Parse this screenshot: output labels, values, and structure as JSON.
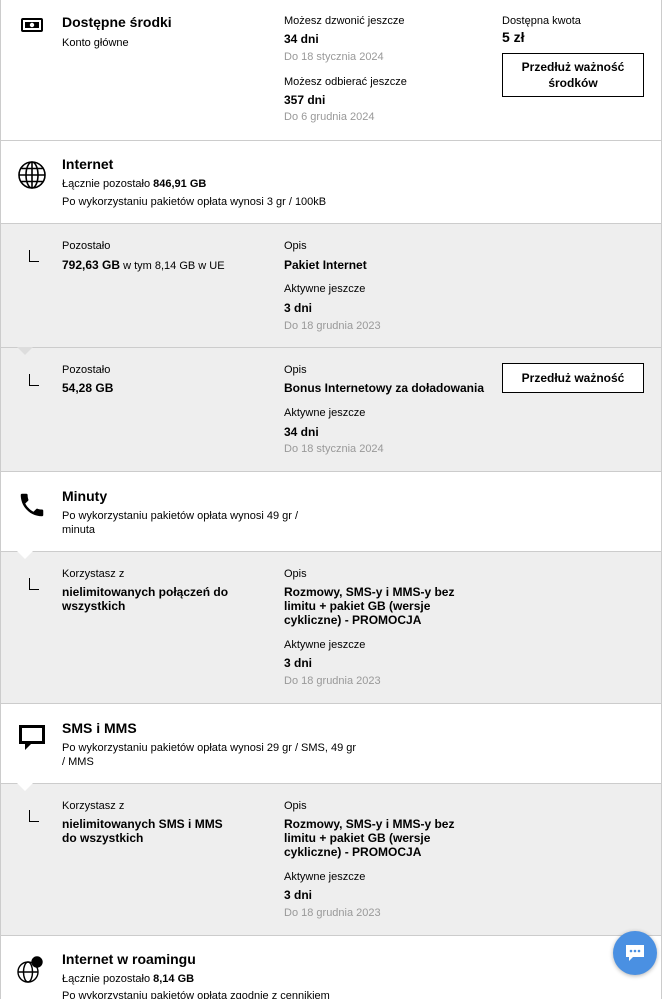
{
  "funds": {
    "title": "Dostępne środki",
    "subtitle": "Konto główne",
    "call_label": "Możesz dzwonić jeszcze",
    "call_value": "34 dni",
    "call_date": "Do 18 stycznia 2024",
    "receive_label": "Możesz odbierać jeszcze",
    "receive_value": "357 dni",
    "receive_date": "Do 6 grudnia 2024",
    "amount_label": "Dostępna kwota",
    "amount_value": "5 zł",
    "extend_button": "Przedłuż ważność środków"
  },
  "internet": {
    "title": "Internet",
    "total_prefix": "Łącznie pozostało",
    "total_value": "846,91 GB",
    "after_note": "Po wykorzystaniu pakietów opłata wynosi 3 gr / 100kB",
    "packages": [
      {
        "left_label": "Pozostało",
        "left_value": "792,63 GB",
        "left_extra": "w tym 8,14 GB w UE",
        "desc_label": "Opis",
        "desc_value": "Pakiet Internet",
        "active_label": "Aktywne jeszcze",
        "active_value": "3 dni",
        "active_date": "Do 18 grudnia 2023"
      },
      {
        "left_label": "Pozostało",
        "left_value": "54,28 GB",
        "left_extra": "",
        "desc_label": "Opis",
        "desc_value": "Bonus Internetowy za doładowania",
        "active_label": "Aktywne jeszcze",
        "active_value": "34 dni",
        "active_date": "Do 18 stycznia 2024",
        "button": "Przedłuż ważność"
      }
    ]
  },
  "minutes": {
    "title": "Minuty",
    "after_note": "Po wykorzystaniu pakietów opłata wynosi 49 gr / minuta",
    "package": {
      "left_label": "Korzystasz z",
      "left_value": "nielimitowanych połączeń do wszystkich",
      "desc_label": "Opis",
      "desc_value": "Rozmowy, SMS-y i MMS-y bez limitu + pakiet GB (wersje cykliczne) - PROMOCJA",
      "active_label": "Aktywne jeszcze",
      "active_value": "3 dni",
      "active_date": "Do 18 grudnia 2023"
    }
  },
  "sms": {
    "title": "SMS i MMS",
    "after_note": "Po wykorzystaniu pakietów opłata wynosi 29 gr / SMS, 49 gr / MMS",
    "package": {
      "left_label": "Korzystasz z",
      "left_value": "nielimitowanych SMS i MMS do wszystkich",
      "desc_label": "Opis",
      "desc_value": "Rozmowy, SMS-y i MMS-y bez limitu + pakiet GB (wersje cykliczne) - PROMOCJA",
      "active_label": "Aktywne jeszcze",
      "active_value": "3 dni",
      "active_date": "Do 18 grudnia 2023"
    }
  },
  "roaming": {
    "title": "Internet w roamingu",
    "total_prefix": "Łącznie pozostało",
    "total_value": "8,14 GB",
    "after_note": "Po wykorzystaniu pakietów opłata zgodnie z cennikiem"
  },
  "colors": {
    "grey_bg": "#eeeeee",
    "muted": "#999999",
    "chat": "#4a90e2"
  }
}
